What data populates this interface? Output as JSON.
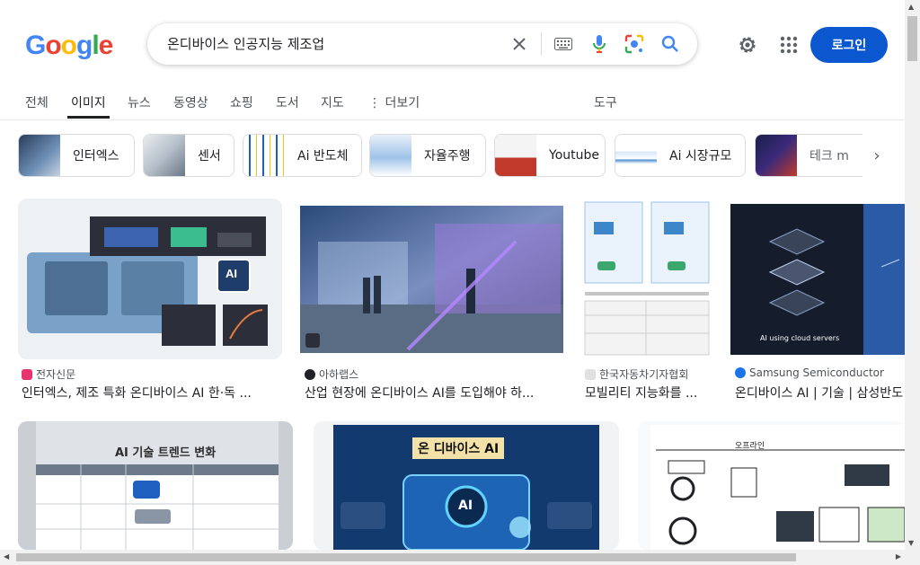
{
  "logo": {
    "letters": [
      "G",
      "o",
      "o",
      "g",
      "l",
      "e"
    ],
    "colors": [
      "#4285F4",
      "#EA4335",
      "#FBBC05",
      "#4285F4",
      "#34A853",
      "#EA4335"
    ]
  },
  "search": {
    "query": "온디바이스 인공지능 제조업"
  },
  "header": {
    "login_label": "로그인"
  },
  "tabs": [
    "전체",
    "이미지",
    "뉴스",
    "동영상",
    "쇼핑",
    "도서",
    "지도",
    "더보기"
  ],
  "tools_label": "도구",
  "chips": [
    "인터엑스",
    "센서",
    "Ai 반도체",
    "자율주행",
    "Youtube",
    "Ai 시장규모",
    "테크 m"
  ],
  "results": [
    {
      "source": "전자신문",
      "title": "인터엑스, 제조 특화 온디바이스 AI 한·독 ...",
      "fav": "#e8336d"
    },
    {
      "source": "아하랩스",
      "title": "산업 현장에 온디바이스 AI를 도입해야 하...",
      "fav": "#202124"
    },
    {
      "source": "한국자동차기자협회",
      "title": "모빌리티 지능화를 ...",
      "fav": "#e0e0e0"
    },
    {
      "source": "Samsung Semiconductor",
      "title": "온디바이스 AI | 기술 | 삼성반도",
      "fav": "#1a73e8"
    }
  ],
  "image_text": {
    "ai_badge": "AI",
    "cloud_caption": "AI using cloud servers",
    "trend_title": "AI 기술 트렌드 변화",
    "ondevice_title": "온 디바이스 AI",
    "diagram_title": "오프라인"
  },
  "colors": {
    "accent": "#0b57d0",
    "muted": "#4d5156"
  }
}
